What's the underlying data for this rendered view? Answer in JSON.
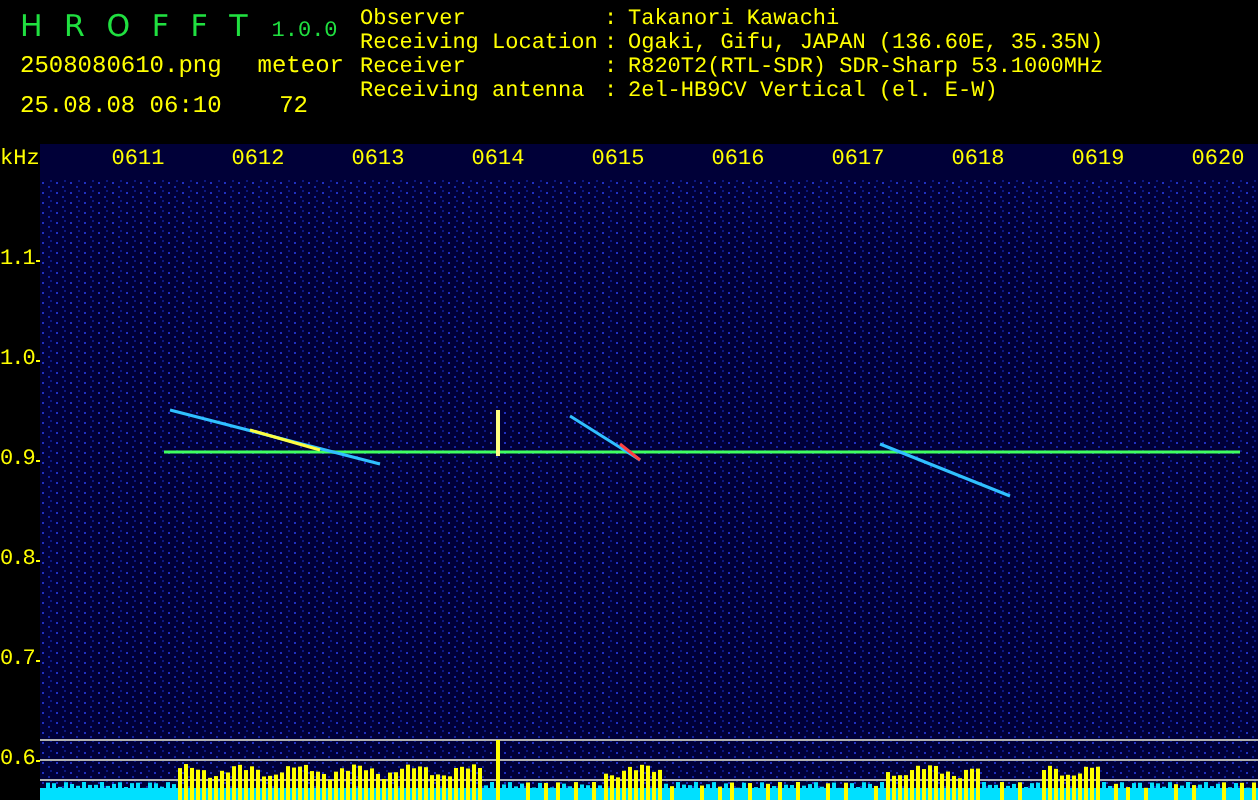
{
  "app": {
    "name": "H R O F F T",
    "version": "1.0.0"
  },
  "file": "2508080610.png",
  "timestamp": "25.08.08 06:10",
  "counter": {
    "label": "meteor",
    "value": "72"
  },
  "info": [
    {
      "label": "Observer",
      "separator": ":",
      "value": "Takanori Kawachi"
    },
    {
      "label": "Receiving Location",
      "separator": ":",
      "value": "Ogaki, Gifu, JAPAN (136.60E, 35.35N)"
    },
    {
      "label": "Receiver",
      "separator": ":",
      "value": "R820T2(RTL-SDR) SDR-Sharp 53.1000MHz"
    },
    {
      "label": "Receiving antenna",
      "separator": ":",
      "value": "2el-HB9CV Vertical (el. E-W)"
    }
  ],
  "chart": {
    "ylabel": "kHz",
    "yticks": [
      "1.1",
      "1.0",
      "0.9",
      "0.8",
      "0.7",
      "0.6"
    ],
    "xticks": [
      "0611",
      "0612",
      "0613",
      "0614",
      "0615",
      "0616",
      "0617",
      "0618",
      "0619",
      "0620"
    ]
  }
}
